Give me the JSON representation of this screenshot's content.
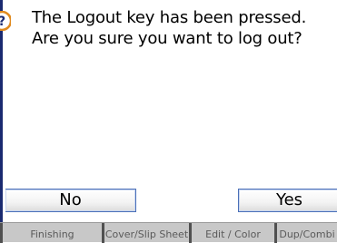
{
  "dialog": {
    "message_line1": "The Logout key has been pressed.",
    "message_line2": "Are you sure you want to log out?",
    "no_label": "No",
    "yes_label": "Yes"
  },
  "tabs": [
    "Finishing",
    "Cover/Slip Sheet",
    "Edit / Color",
    "Dup/Combi"
  ],
  "colors": {
    "dialog_border": "#1a2a70",
    "button_border": "#4a6fb8",
    "tab_bar": "#c8c8c8",
    "icon_orange": "#e08a1e"
  },
  "icons": {
    "question": "question-mark-icon"
  }
}
